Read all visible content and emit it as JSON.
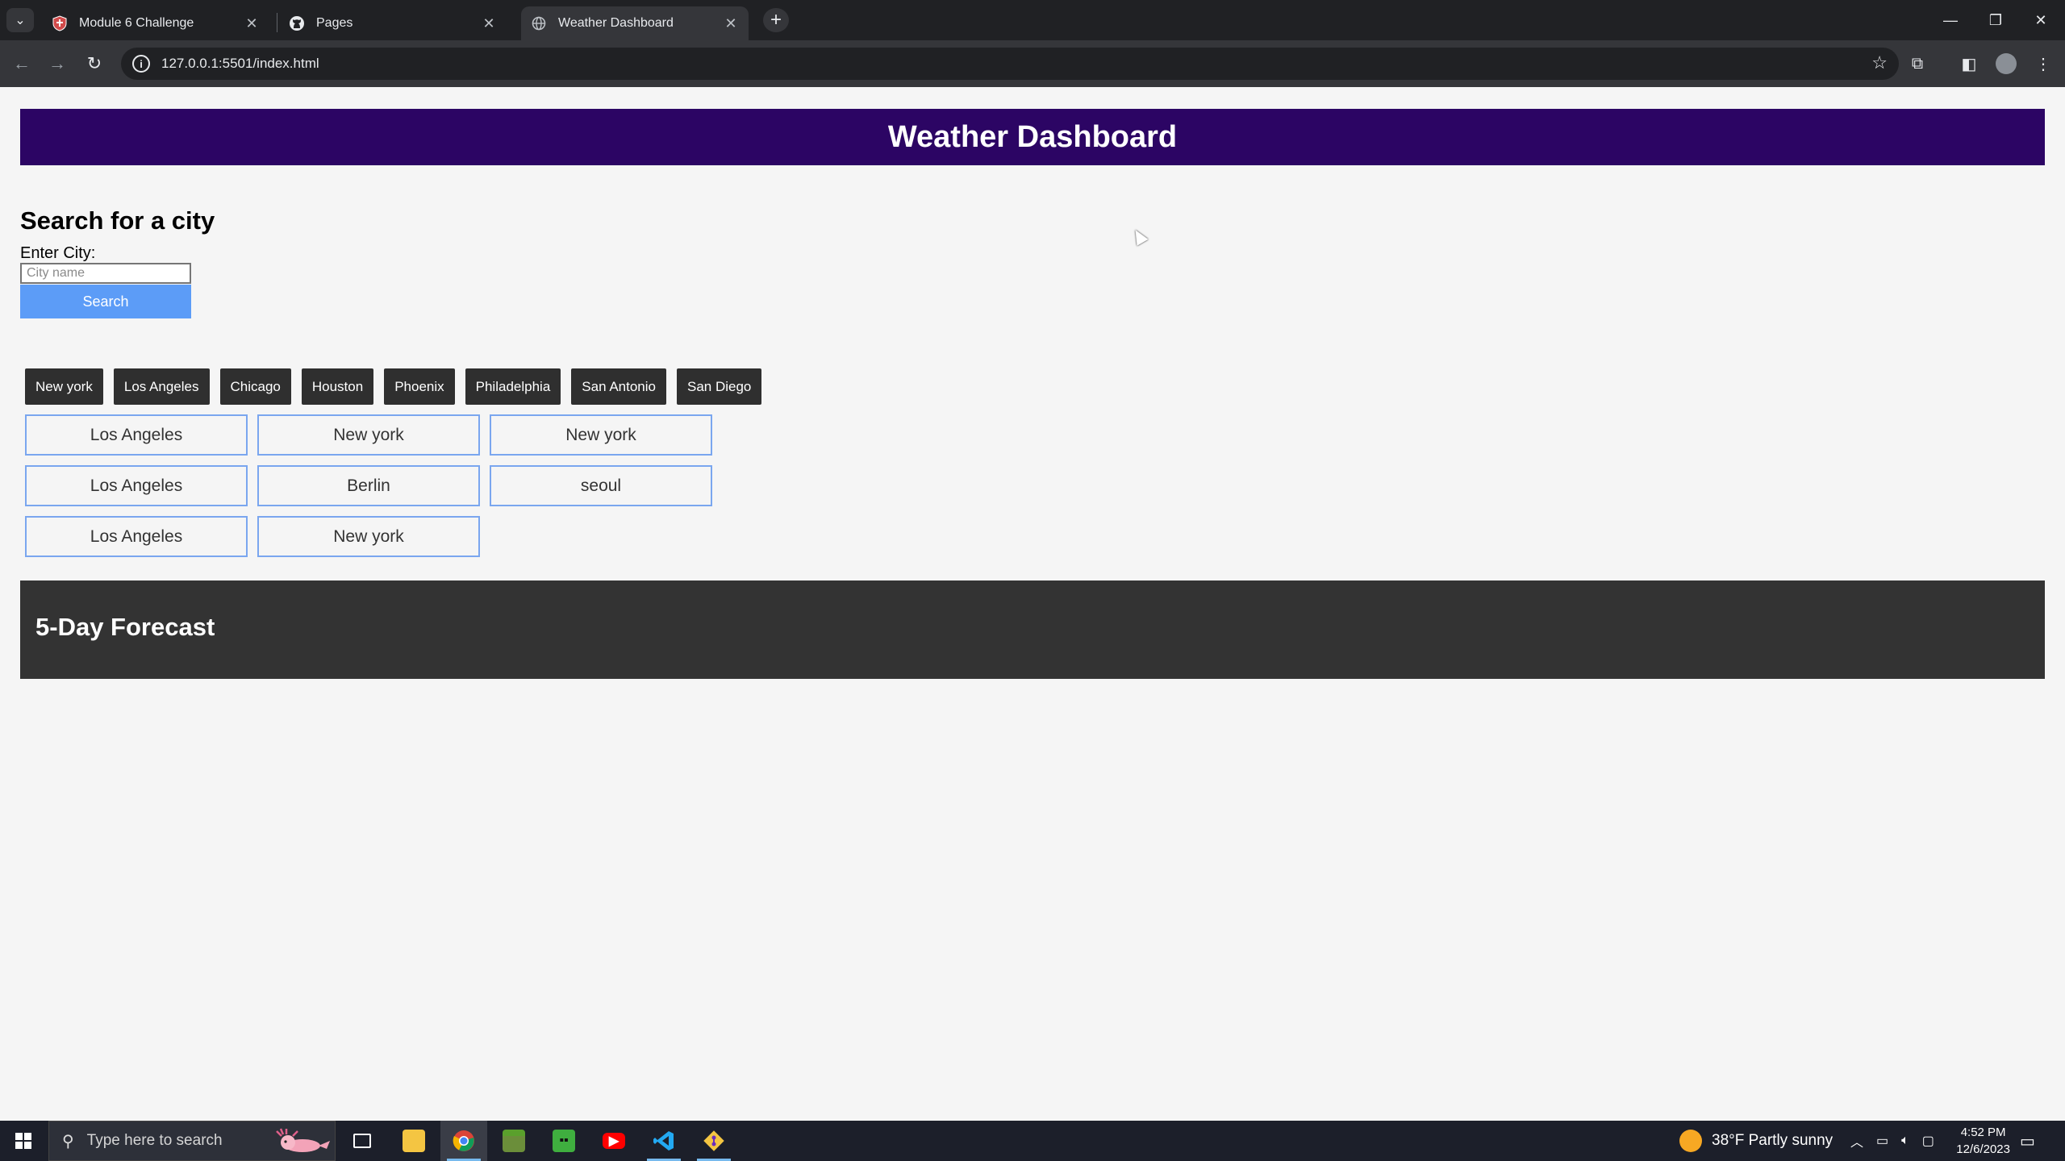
{
  "browser": {
    "tabs": [
      {
        "label": "Module 6 Challenge",
        "icon": "shield-icon"
      },
      {
        "label": "Pages",
        "icon": "github-icon"
      },
      {
        "label": "Weather Dashboard",
        "icon": "globe-icon"
      }
    ],
    "url": "127.0.0.1:5501/index.html"
  },
  "header": {
    "title": "Weather Dashboard"
  },
  "search": {
    "heading": "Search for a city",
    "label": "Enter City:",
    "placeholder": "City name",
    "button": "Search"
  },
  "quick_cities": [
    "New york",
    "Los Angeles",
    "Chicago",
    "Houston",
    "Phoenix",
    "Philadelphia",
    "San Antonio",
    "San Diego"
  ],
  "history": [
    "Los Angeles",
    "New york",
    "New york",
    "Los Angeles",
    "Berlin",
    "seoul",
    "Los Angeles",
    "New york"
  ],
  "forecast": {
    "title": "5-Day Forecast"
  },
  "taskbar": {
    "search_placeholder": "Type here to search",
    "weather": "38°F  Partly sunny",
    "time": "4:52 PM",
    "date": "12/6/2023"
  },
  "colors": {
    "header_bg": "#2c0564",
    "search_button": "#5c9cf7",
    "quick_button": "#2f2f2f",
    "history_border": "#7aa6ef",
    "forecast_bg": "#333333"
  }
}
